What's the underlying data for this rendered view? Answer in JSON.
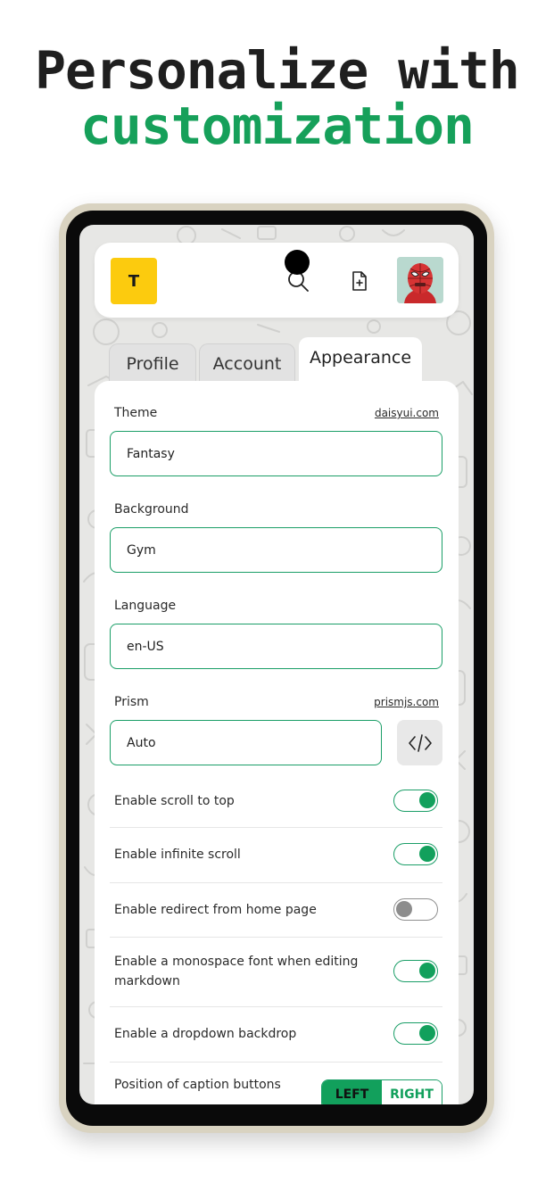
{
  "headline": {
    "line1": "Personalize with",
    "line2": "customization"
  },
  "appbar": {
    "logo_letter": "T",
    "search_icon": "search-icon",
    "new_file_icon": "file-plus-icon",
    "avatar": "spider-man-avatar"
  },
  "tabs": [
    {
      "label": "Profile",
      "active": false
    },
    {
      "label": "Account",
      "active": false
    },
    {
      "label": "Appearance",
      "active": true
    }
  ],
  "settings": {
    "theme": {
      "label": "Theme",
      "link": "daisyui.com",
      "value": "Fantasy"
    },
    "background": {
      "label": "Background",
      "value": "Gym"
    },
    "language": {
      "label": "Language",
      "value": "en-US"
    },
    "prism": {
      "label": "Prism",
      "link": "prismjs.com",
      "value": "Auto",
      "icon": "code-icon"
    }
  },
  "toggles": [
    {
      "label": "Enable scroll to top",
      "enabled": true
    },
    {
      "label": "Enable infinite scroll",
      "enabled": true
    },
    {
      "label": "Enable redirect from home page",
      "enabled": false
    },
    {
      "label": "Enable a monospace font when editing markdown",
      "enabled": true
    },
    {
      "label": "Enable a dropdown backdrop",
      "enabled": true
    }
  ],
  "caption_buttons": {
    "label": "Position of caption buttons",
    "options": [
      "LEFT",
      "RIGHT"
    ],
    "selected": "LEFT"
  },
  "colors": {
    "accent": "#12a05c",
    "logo": "#fccb0e",
    "headline_accent": "#16a05a"
  }
}
